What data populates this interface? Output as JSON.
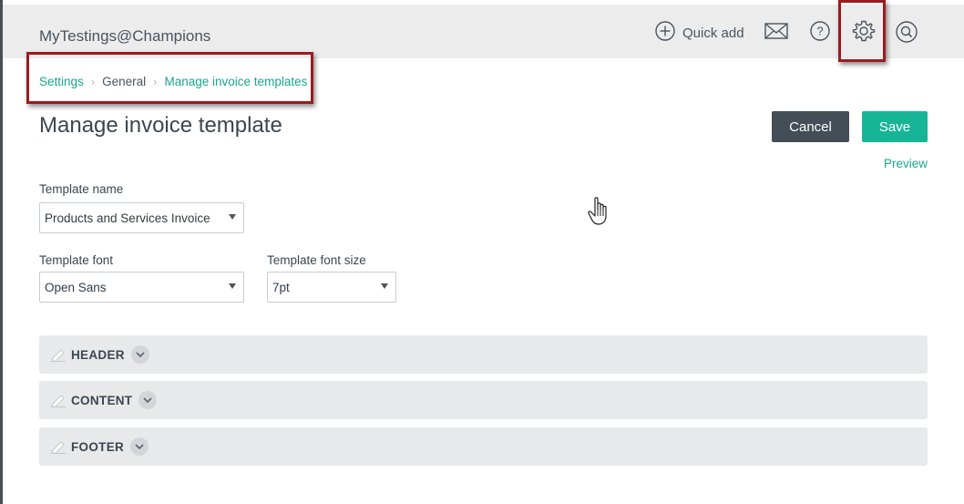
{
  "header": {
    "company_name": "MyTestings@Champions",
    "quick_add_label": "Quick add",
    "icons": [
      "plus-circle-icon",
      "mail-icon",
      "help-icon",
      "gear-icon",
      "search-icon"
    ]
  },
  "breadcrumb": {
    "items": [
      "Settings",
      "General",
      "Manage invoice templates"
    ]
  },
  "page": {
    "title": "Manage invoice template",
    "cancel_label": "Cancel",
    "save_label": "Save",
    "preview_label": "Preview"
  },
  "form": {
    "template_name_label": "Template name",
    "template_name_value": "Products and Services Invoice",
    "template_font_label": "Template font",
    "template_font_value": "Open Sans",
    "template_font_size_label": "Template font size",
    "template_font_size_value": "7pt"
  },
  "sections": [
    {
      "label": "HEADER"
    },
    {
      "label": "CONTENT"
    },
    {
      "label": "FOOTER"
    }
  ],
  "colors": {
    "accent": "#16b597",
    "link": "#1aa58e",
    "cancel": "#454e57",
    "annotation": "#9b1b1f",
    "topbar": "#ececed",
    "section_bg": "#e8e9ea"
  }
}
